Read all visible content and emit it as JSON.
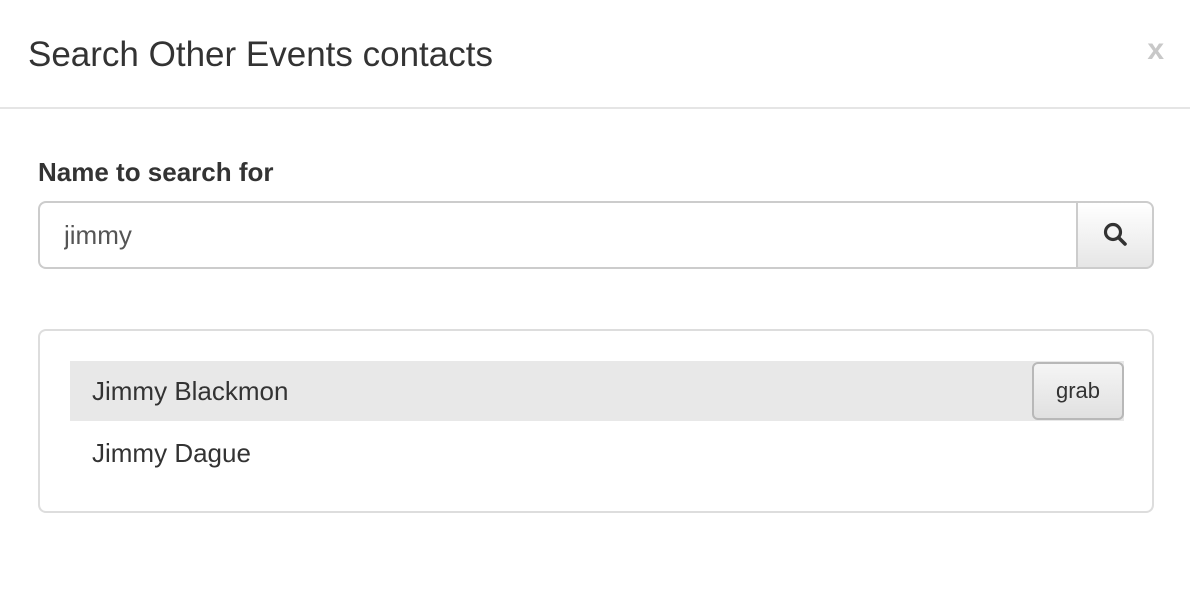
{
  "dialog": {
    "title": "Search Other Events contacts",
    "close_label": "x"
  },
  "search": {
    "label": "Name to search for",
    "value": "jimmy",
    "button_icon": "search-icon"
  },
  "results": [
    {
      "name": "Jimmy Blackmon",
      "action_label": "grab",
      "highlighted": true
    },
    {
      "name": "Jimmy Dague",
      "highlighted": false
    }
  ]
}
